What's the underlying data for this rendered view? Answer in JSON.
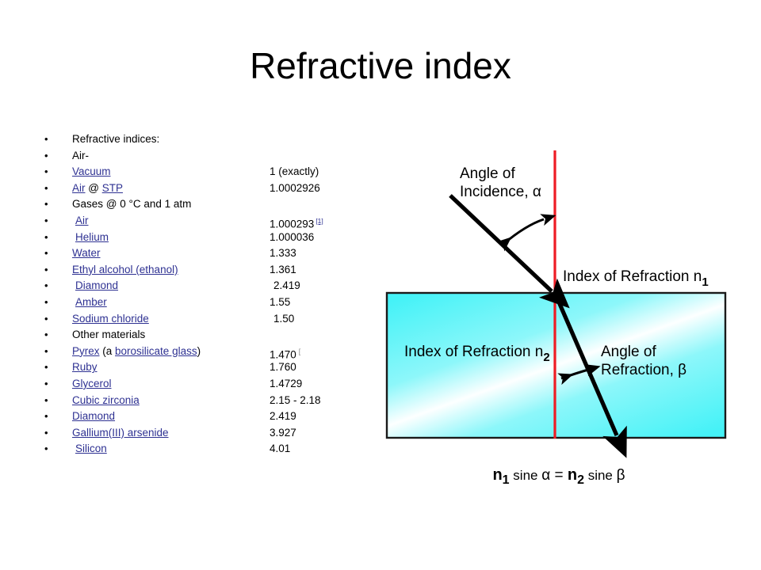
{
  "slide": {
    "title": "Refractive index",
    "bullet_glyph": "•"
  },
  "list": [
    {
      "segments": [
        {
          "text": "Refractive indices:",
          "link": false
        }
      ],
      "value": "",
      "indent": 0
    },
    {
      "segments": [
        {
          "text": "Air-",
          "link": false
        }
      ],
      "value": "",
      "indent": 0
    },
    {
      "segments": [
        {
          "text": "Vacuum",
          "link": true
        }
      ],
      "value": "1 (exactly)",
      "indent": 0
    },
    {
      "segments": [
        {
          "text": "Air",
          "link": true
        },
        {
          "text": " @ ",
          "link": false
        },
        {
          "text": "STP",
          "link": true
        }
      ],
      "value": "1.0002926",
      "indent": 0
    },
    {
      "segments": [
        {
          "text": "Gases @ 0 °C and 1 atm",
          "link": false
        }
      ],
      "value": "",
      "indent": 0
    },
    {
      "segments": [
        {
          "text": "Air",
          "link": true
        }
      ],
      "value": "1.000293",
      "cite": "[1]",
      "indent": 1
    },
    {
      "segments": [
        {
          "text": "Helium",
          "link": true
        }
      ],
      "value": "1.000036",
      "indent": 1
    },
    {
      "segments": [
        {
          "text": "Water",
          "link": true
        }
      ],
      "value": "1.333",
      "indent": 0
    },
    {
      "segments": [
        {
          "text": "Ethyl alcohol (ethanol)",
          "link": true
        }
      ],
      "value": "1.361",
      "indent": 0
    },
    {
      "segments": [
        {
          "text": "Diamond",
          "link": true
        }
      ],
      "value": "2.419",
      "indent": 1,
      "value_pad": true
    },
    {
      "segments": [
        {
          "text": "Amber",
          "link": true
        }
      ],
      "value": "1.55",
      "indent": 1
    },
    {
      "segments": [
        {
          "text": "Sodium chloride",
          "link": true
        }
      ],
      "value": "1.50",
      "indent": 0,
      "value_pad": true
    },
    {
      "segments": [
        {
          "text": "Other materials",
          "link": false
        }
      ],
      "value": "",
      "indent": 0
    },
    {
      "segments": [
        {
          "text": "Pyrex",
          "link": true
        },
        {
          "text": " (a ",
          "link": false
        },
        {
          "text": "borosilicate glass",
          "link": true
        },
        {
          "text": ")",
          "link": false
        }
      ],
      "value": "1.470",
      "cite_cut": "[",
      "indent": 0
    },
    {
      "segments": [
        {
          "text": "Ruby",
          "link": true
        }
      ],
      "value": "1.760",
      "indent": 0
    },
    {
      "segments": [
        {
          "text": "Glycerol",
          "link": true
        }
      ],
      "value": "1.4729",
      "indent": 0
    },
    {
      "segments": [
        {
          "text": "Cubic zirconia",
          "link": true
        }
      ],
      "value": "2.15 - 2.18",
      "indent": 0
    },
    {
      "segments": [
        {
          "text": "Diamond",
          "link": true
        }
      ],
      "value": "2.419",
      "indent": 0
    },
    {
      "segments": [
        {
          "text": "Gallium(III) arsenide",
          "link": true
        }
      ],
      "value": "3.927",
      "indent": 0
    },
    {
      "segments": [
        {
          "text": "Silicon",
          "link": true
        }
      ],
      "value": "4.01",
      "indent": 1
    }
  ],
  "diagram": {
    "label_angle_incidence_line1": "Angle of",
    "label_angle_incidence_line2": "Incidence, α",
    "label_index_n1_text": "Index of Refraction n",
    "label_index_n1_sub": "1",
    "label_index_n2_text": "Index of Refraction n",
    "label_index_n2_sub": "2",
    "label_angle_refraction_line1": "Angle of",
    "label_angle_refraction_line2": "Refraction, β",
    "formula": "n₁ sine α  = n₂ sine β",
    "formula_parts": {
      "n1": "n",
      "n1_sub": "1",
      "sine1": " sine ",
      "alpha": "α",
      "eq": " = ",
      "n2": "n",
      "n2_sub": "2",
      "sine2": " sine ",
      "beta": "β"
    },
    "colors": {
      "normal_line": "#ee1c24",
      "ray": "#000000",
      "medium_fill_cyan": "#45f2f7",
      "medium_fill_light": "#ffffff",
      "border": "#1a1a1a"
    }
  }
}
